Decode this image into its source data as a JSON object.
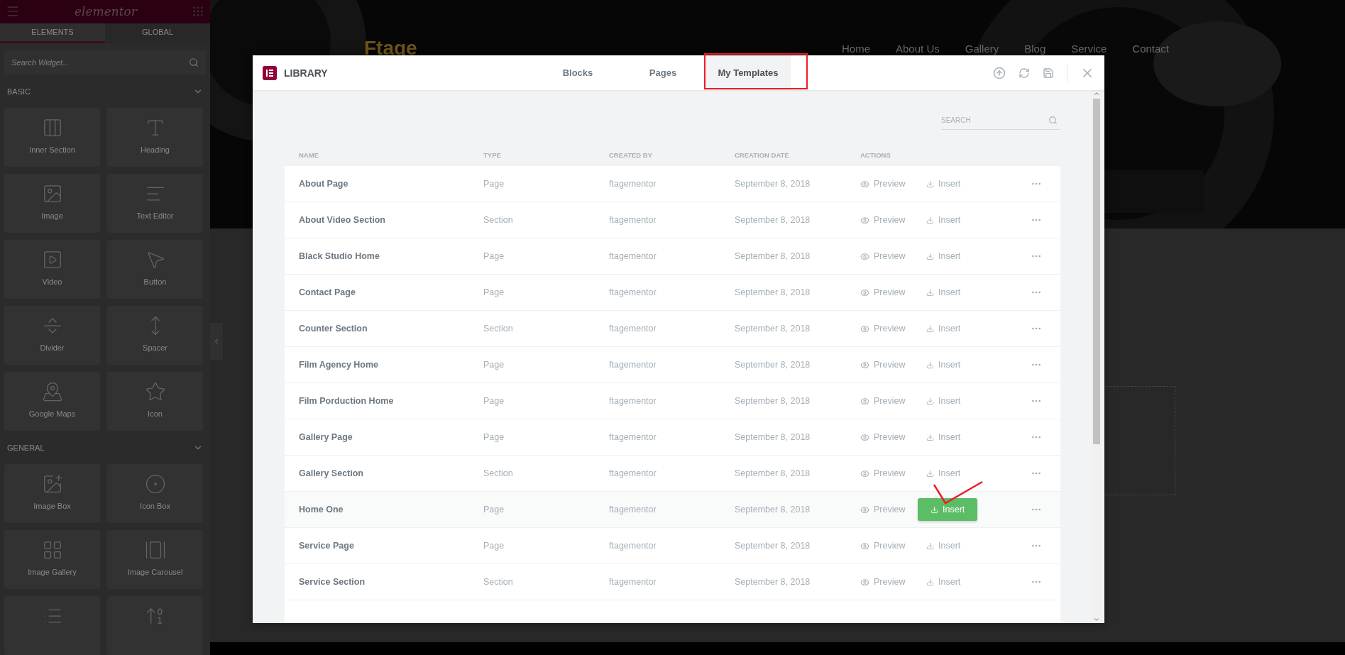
{
  "sidebar": {
    "logo": "elementor",
    "tabs": [
      {
        "label": "ELEMENTS",
        "selected": true
      },
      {
        "label": "GLOBAL",
        "selected": false
      }
    ],
    "search": {
      "placeholder": "Search Widget..."
    },
    "sections": [
      {
        "title": "BASIC",
        "expanded": true,
        "widgets": [
          {
            "label": "Inner Section"
          },
          {
            "label": "Heading"
          },
          {
            "label": "Image"
          },
          {
            "label": "Text Editor"
          },
          {
            "label": "Video"
          },
          {
            "label": "Button"
          },
          {
            "label": "Divider"
          },
          {
            "label": "Spacer"
          },
          {
            "label": "Google Maps"
          },
          {
            "label": "Icon"
          }
        ]
      },
      {
        "title": "GENERAL",
        "expanded": true,
        "widgets": [
          {
            "label": "Image Box"
          },
          {
            "label": "Icon Box"
          },
          {
            "label": "Image Gallery"
          },
          {
            "label": "Image Carousel"
          },
          {
            "cut": true
          },
          {
            "cut": true
          }
        ]
      }
    ]
  },
  "site": {
    "logo": "Ftage",
    "nav": [
      "Home",
      "About Us",
      "Gallery",
      "Blog",
      "Service",
      "Contact"
    ]
  },
  "library": {
    "title": "LIBRARY",
    "tabs": [
      {
        "label": "Blocks",
        "selected": false,
        "annotated": false
      },
      {
        "label": "Pages",
        "selected": false,
        "annotated": false
      },
      {
        "label": "My Templates",
        "selected": true,
        "annotated": true
      }
    ],
    "search": {
      "placeholder": "SEARCH"
    },
    "insert_checkmark": true,
    "columns": [
      "NAME",
      "TYPE",
      "CREATED BY",
      "CREATION DATE",
      "ACTIONS"
    ],
    "rows": [
      {
        "name": "About Page",
        "type": "Page",
        "author": "ftagementor",
        "date": "September 8, 2018",
        "preview": "Preview",
        "insert": "Insert",
        "highlighted": false
      },
      {
        "name": "About Video Section",
        "type": "Section",
        "author": "ftagementor",
        "date": "September 8, 2018",
        "preview": "Preview",
        "insert": "Insert",
        "highlighted": false
      },
      {
        "name": "Black Studio Home",
        "type": "Page",
        "author": "ftagementor",
        "date": "September 8, 2018",
        "preview": "Preview",
        "insert": "Insert",
        "highlighted": false
      },
      {
        "name": "Contact Page",
        "type": "Page",
        "author": "ftagementor",
        "date": "September 8, 2018",
        "preview": "Preview",
        "insert": "Insert",
        "highlighted": false
      },
      {
        "name": "Counter Section",
        "type": "Section",
        "author": "ftagementor",
        "date": "September 8, 2018",
        "preview": "Preview",
        "insert": "Insert",
        "highlighted": false
      },
      {
        "name": "Film Agency Home",
        "type": "Page",
        "author": "ftagementor",
        "date": "September 8, 2018",
        "preview": "Preview",
        "insert": "Insert",
        "highlighted": false
      },
      {
        "name": "Film Porduction Home",
        "type": "Page",
        "author": "ftagementor",
        "date": "September 8, 2018",
        "preview": "Preview",
        "insert": "Insert",
        "highlighted": false
      },
      {
        "name": "Gallery Page",
        "type": "Page",
        "author": "ftagementor",
        "date": "September 8, 2018",
        "preview": "Preview",
        "insert": "Insert",
        "highlighted": false
      },
      {
        "name": "Gallery Section",
        "type": "Section",
        "author": "ftagementor",
        "date": "September 8, 2018",
        "preview": "Preview",
        "insert": "Insert",
        "highlighted": false
      },
      {
        "name": "Home One",
        "type": "Page",
        "author": "ftagementor",
        "date": "September 8, 2018",
        "preview": "Preview",
        "insert": "Insert",
        "highlighted": true
      },
      {
        "name": "Service Page",
        "type": "Page",
        "author": "ftagementor",
        "date": "September 8, 2018",
        "preview": "Preview",
        "insert": "Insert",
        "highlighted": false
      },
      {
        "name": "Service Section",
        "type": "Section",
        "author": "ftagementor",
        "date": "September 8, 2018",
        "preview": "Preview",
        "insert": "Insert",
        "highlighted": false
      }
    ]
  }
}
